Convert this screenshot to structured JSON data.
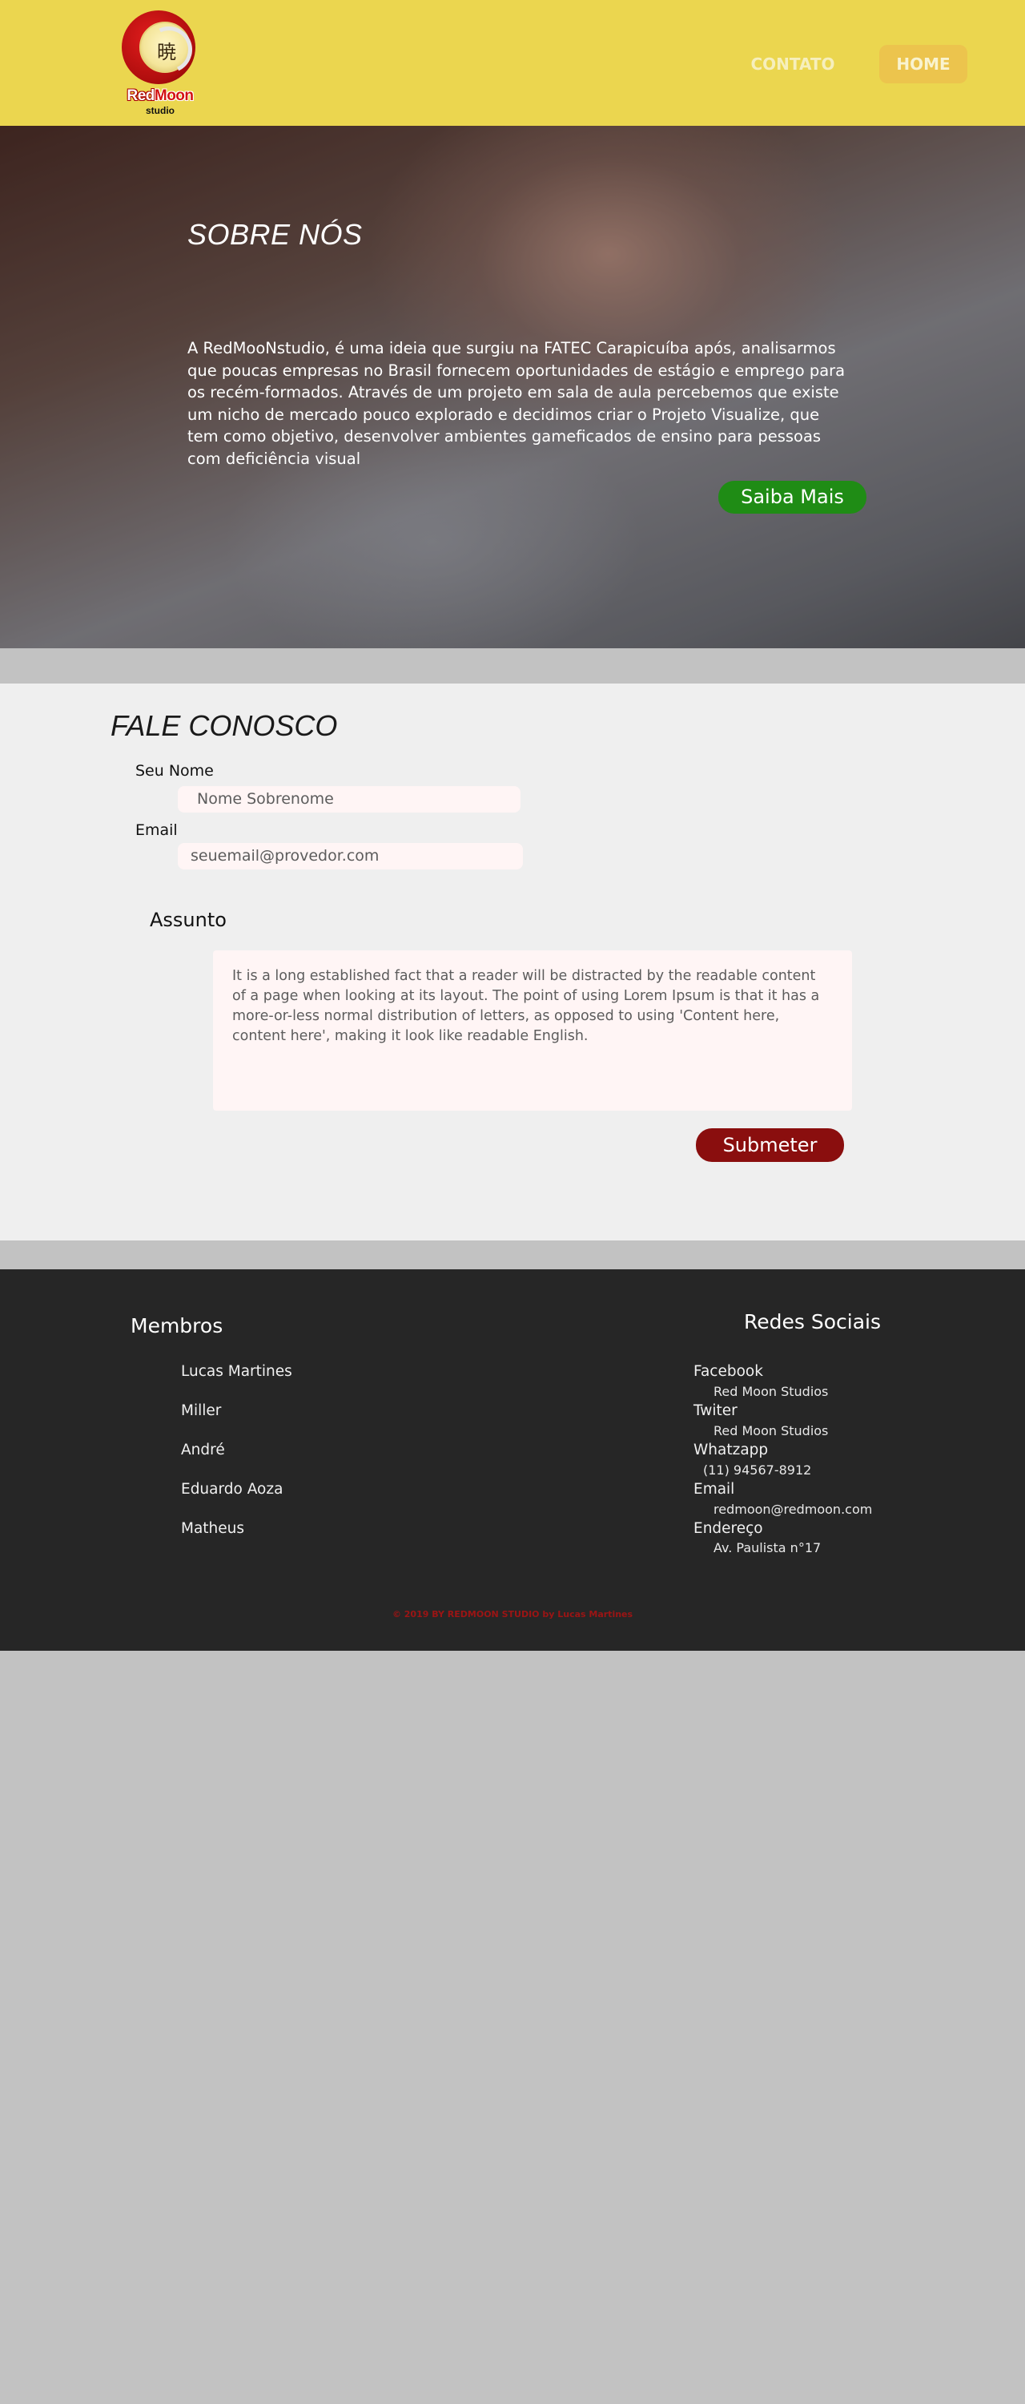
{
  "header": {
    "logo": {
      "kanji": "暁",
      "word_red": "Red",
      "word_moon": "Moon",
      "sub": "studio"
    },
    "nav": {
      "contato": "CONTATO",
      "home": "HOME"
    }
  },
  "hero": {
    "title": "SOBRE NÓS",
    "paragraph": "A RedMooNstudio, é uma  ideia que surgiu na FATEC Carapicuíba após, analisarmos que poucas empresas no Brasil fornecem oportunidades de estágio e emprego para os recém-formados. Através de um projeto em sala de aula percebemos que existe um nicho de mercado pouco explorado e decidimos criar o Projeto Visualize, que tem como objetivo, desenvolver ambientes gameficados de ensino para pessoas com deficiência visual",
    "button": "Saiba Mais"
  },
  "contact": {
    "title": "FALE CONOSCO",
    "name_label": "Seu Nome",
    "name_placeholder": "Nome Sobrenome",
    "email_label": "Email",
    "email_placeholder": "seuemail@provedor.com",
    "subject_label": "Assunto",
    "message": "It is a long established fact that a reader will be distracted by the readable content of a page when looking at its layout. The point of using Lorem Ipsum is that it has a more-or-less normal distribution of letters, as opposed to using 'Content here, content here', making it look like readable English.",
    "submit": "Submeter"
  },
  "footer": {
    "members_title": "Membros",
    "members": [
      "Lucas Martines",
      "Miller",
      "André",
      "Eduardo Aoza",
      "Matheus"
    ],
    "social_title": "Redes Sociais",
    "social": [
      {
        "label": "Facebook",
        "value": "Red Moon Studios"
      },
      {
        "label": "Twiter",
        "value": "Red Moon Studios"
      },
      {
        "label": "Whatzapp",
        "value": "(11) 94567-8912"
      },
      {
        "label": "Email",
        "value": "redmoon@redmoon.com"
      },
      {
        "label": "Endereço",
        "value": "Av. Paulista n°17"
      }
    ],
    "copyright": "© 2019 BY REDMOON STUDIO by Lucas Martines"
  },
  "colors": {
    "header_bg": "#ebd64f",
    "accent_green": "#1f8c15",
    "accent_red": "#8a0e0e",
    "footer_bg": "#262626"
  }
}
